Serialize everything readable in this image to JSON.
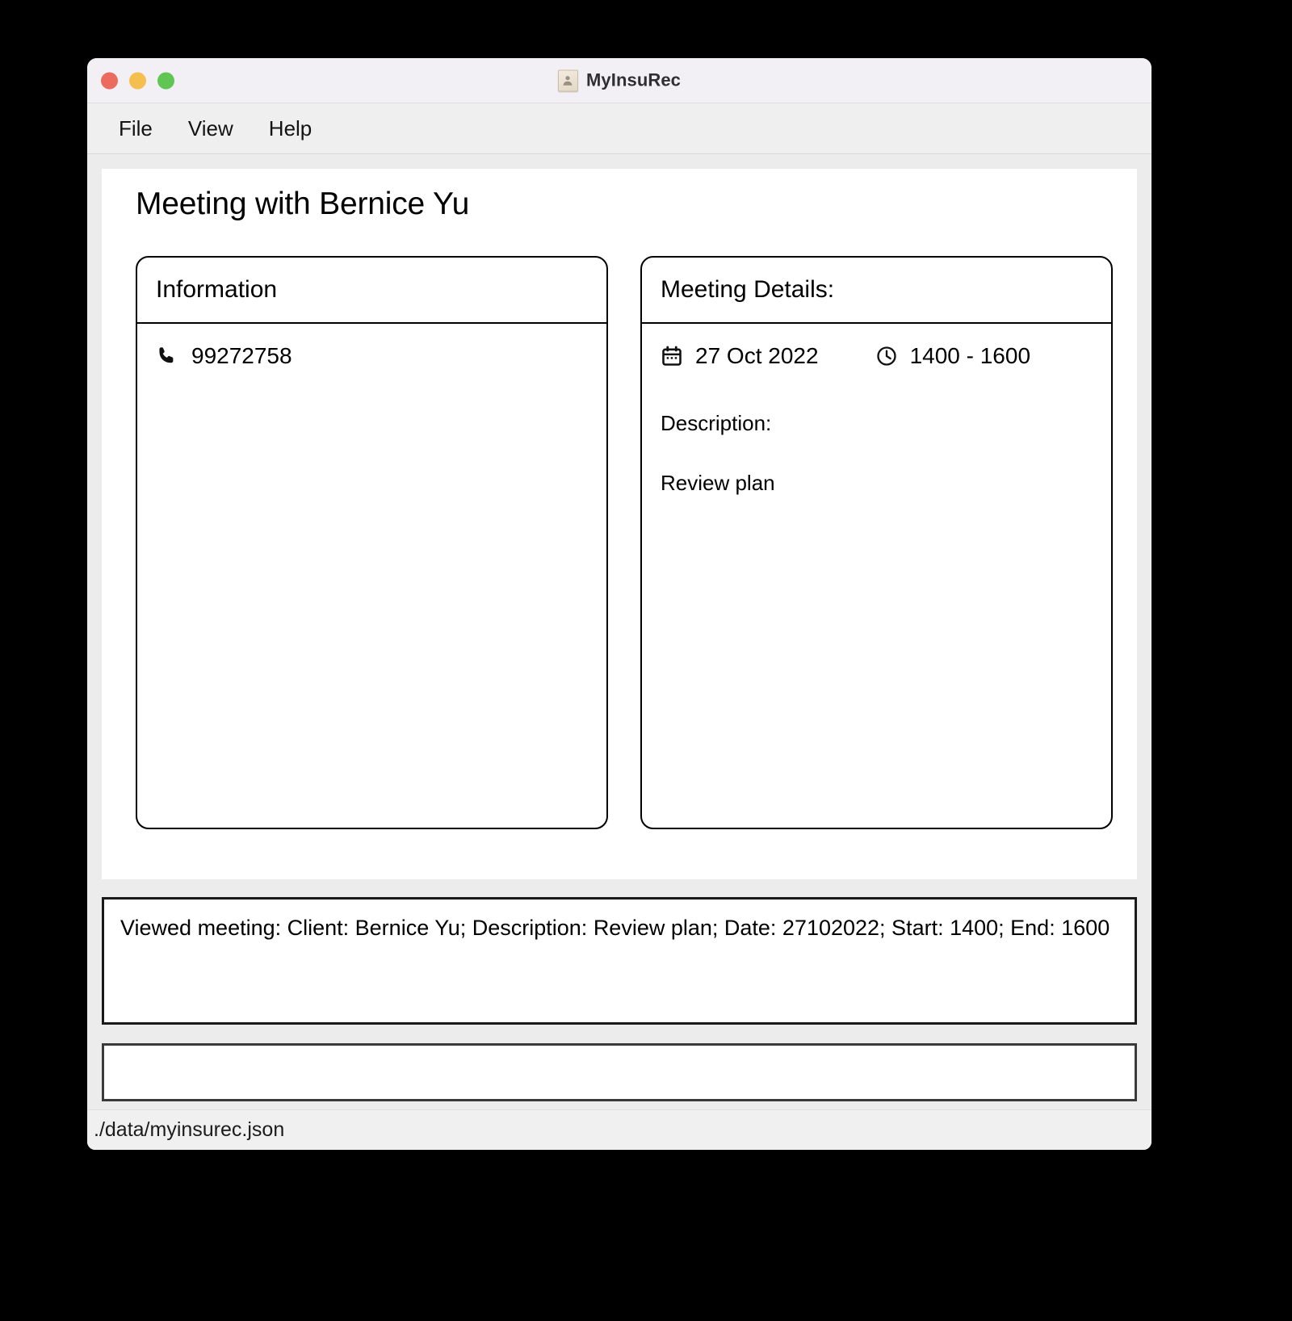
{
  "window": {
    "title": "MyInsuRec",
    "app_icon": "contact-card-icon",
    "traffic_lights": {
      "close_color": "#ED6A5E",
      "minimize_color": "#F5BF4F",
      "maximize_color": "#61C554"
    }
  },
  "menubar": {
    "items": [
      {
        "label": "File"
      },
      {
        "label": "View"
      },
      {
        "label": "Help"
      }
    ]
  },
  "main": {
    "page_title": "Meeting with Bernice Yu",
    "information_panel": {
      "header": "Information",
      "phone_icon": "phone-icon",
      "phone": "99272758"
    },
    "meeting_details_panel": {
      "header": "Meeting Details:",
      "calendar_icon": "calendar-icon",
      "date": "27 Oct 2022",
      "clock_icon": "clock-icon",
      "time_range": "1400 - 1600",
      "description_label": "Description:",
      "description_value": "Review plan"
    }
  },
  "result": {
    "text": "Viewed meeting: Client: Bernice Yu; Description: Review plan; Date: 27102022; Start: 1400; End: 1600"
  },
  "command": {
    "value": "",
    "placeholder": ""
  },
  "statusbar": {
    "file_path": "./data/myinsurec.json"
  }
}
